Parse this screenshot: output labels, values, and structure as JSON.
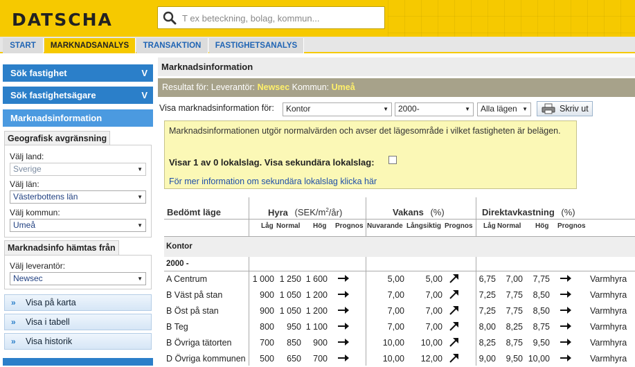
{
  "header": {
    "logo": "DATSCHA",
    "search_placeholder": "T ex beteckning, bolag, kommun..."
  },
  "nav": [
    "START",
    "MARKNADSANALYS",
    "TRANSAKTION",
    "FASTIGHETSANALYS"
  ],
  "sidebar": {
    "search_property": "Sök fastighet",
    "search_owner": "Sök fastighetsägare",
    "market_info": "Marknadsinformation",
    "geo_title": "Geografisk avgränsning",
    "country_label": "Välj land:",
    "country_value": "Sverige",
    "county_label": "Välj län:",
    "county_value": "Västerbottens län",
    "municipality_label": "Välj kommun:",
    "municipality_value": "Umeå",
    "source_title": "Marknadsinfo hämtas från",
    "supplier_label": "Välj leverantör:",
    "supplier_value": "Newsec",
    "actions": [
      "Visa på karta",
      "Visa i tabell",
      "Visa historik"
    ],
    "chevron": "V"
  },
  "main": {
    "title": "Marknadsinformation",
    "result_prefix": "Resultat för: Leverantör:",
    "result_supplier": "Newsec",
    "result_mid": "Kommun:",
    "result_municipality": "Umeå",
    "filter_label": "Visa marknadsinformation för:",
    "filter_type": "Kontor",
    "filter_year": "2000-",
    "filter_location": "Alla lägen",
    "print_label": "Skriv ut"
  },
  "info": {
    "text": "Marknadsinformationen utgör normalvärden och avser det lägesområde i vilket fastigheten är belägen.",
    "secondary": "Visar 1 av 0 lokalslag. Visa sekundära lokalslag:",
    "link": "För mer information om sekundära lokalslag klicka här"
  },
  "table": {
    "headers": {
      "location": "Bedömt läge",
      "rent": "Hyra",
      "rent_unit_a": "(SEK/m",
      "rent_unit_sup": "2",
      "rent_unit_b": "/år)",
      "vacancy": "Vakans",
      "vacancy_unit": "(%)",
      "yield": "Direktavkastning",
      "yield_unit": "(%)"
    },
    "subheaders": {
      "rent": [
        "Låg",
        "Normal",
        "Hög",
        "Prognos"
      ],
      "vacancy": [
        "Nuvarande",
        "Långsiktig",
        "Prognos"
      ],
      "yield": [
        "Låg",
        "Normal",
        "Hög",
        "Prognos"
      ]
    },
    "group": "Kontor",
    "period": "2000 -",
    "rows": [
      {
        "loc": "A Centrum",
        "low": "1 000",
        "norm": "1 250",
        "high": "1 600",
        "rp": "right",
        "vn": "5,00",
        "vl": "5,00",
        "vp": "up",
        "yl": "6,75",
        "yn": "7,00",
        "yh": "7,75",
        "yp": "right",
        "type": "Varmhyra"
      },
      {
        "loc": "B Väst på stan",
        "low": "900",
        "norm": "1 050",
        "high": "1 200",
        "rp": "right",
        "vn": "7,00",
        "vl": "7,00",
        "vp": "up",
        "yl": "7,25",
        "yn": "7,75",
        "yh": "8,50",
        "yp": "right",
        "type": "Varmhyra"
      },
      {
        "loc": "B Öst på stan",
        "low": "900",
        "norm": "1 050",
        "high": "1 200",
        "rp": "right",
        "vn": "7,00",
        "vl": "7,00",
        "vp": "up",
        "yl": "7,25",
        "yn": "7,75",
        "yh": "8,50",
        "yp": "right",
        "type": "Varmhyra"
      },
      {
        "loc": "B Teg",
        "low": "800",
        "norm": "950",
        "high": "1 100",
        "rp": "right",
        "vn": "7,00",
        "vl": "7,00",
        "vp": "up",
        "yl": "8,00",
        "yn": "8,25",
        "yh": "8,75",
        "yp": "right",
        "type": "Varmhyra"
      },
      {
        "loc": "B Övriga tätorten",
        "low": "700",
        "norm": "850",
        "high": "900",
        "rp": "right",
        "vn": "10,00",
        "vl": "10,00",
        "vp": "up",
        "yl": "8,25",
        "yn": "8,75",
        "yh": "9,50",
        "yp": "right",
        "type": "Varmhyra"
      },
      {
        "loc": "D Övriga kommunen",
        "low": "500",
        "norm": "650",
        "high": "700",
        "rp": "right",
        "vn": "10,00",
        "vl": "12,00",
        "vp": "up",
        "yl": "9,00",
        "yn": "9,50",
        "yh": "10,00",
        "yp": "right",
        "type": "Varmhyra"
      }
    ]
  }
}
